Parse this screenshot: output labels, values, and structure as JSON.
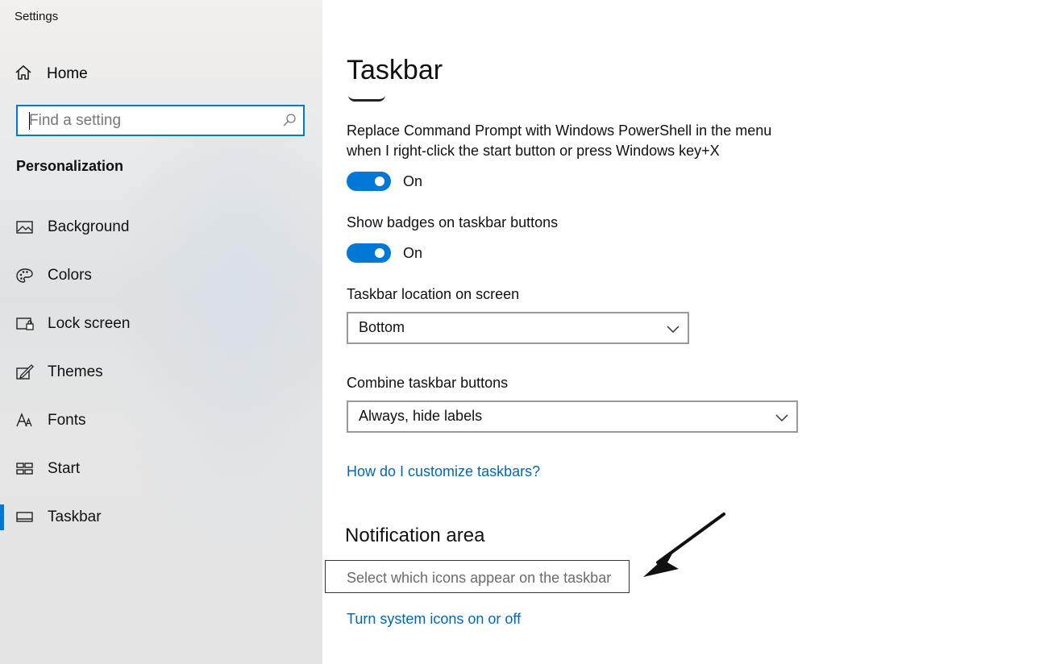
{
  "window": {
    "title": "Settings"
  },
  "sidebar": {
    "home_label": "Home",
    "search": {
      "placeholder": "Find a setting"
    },
    "section_title": "Personalization",
    "items": [
      {
        "label": "Background",
        "icon": "picture-icon"
      },
      {
        "label": "Colors",
        "icon": "palette-icon"
      },
      {
        "label": "Lock screen",
        "icon": "lock-screen-icon"
      },
      {
        "label": "Themes",
        "icon": "themes-icon"
      },
      {
        "label": "Fonts",
        "icon": "fonts-icon"
      },
      {
        "label": "Start",
        "icon": "start-icon"
      },
      {
        "label": "Taskbar",
        "icon": "taskbar-icon",
        "selected": true
      }
    ]
  },
  "main": {
    "title": "Taskbar",
    "powershell": {
      "label_line1": "Replace Command Prompt with Windows PowerShell in the menu",
      "label_line2": "when I right-click the start button or press Windows key+X",
      "state": "On"
    },
    "badges": {
      "label": "Show badges on taskbar buttons",
      "state": "On"
    },
    "location": {
      "label": "Taskbar location on screen",
      "value": "Bottom"
    },
    "combine": {
      "label": "Combine taskbar buttons",
      "value": "Always, hide labels"
    },
    "help_link": "How do I customize taskbars?",
    "notification": {
      "heading": "Notification area",
      "select_icons_link": "Select which icons appear on the taskbar",
      "system_icons_link": "Turn system icons on or off"
    }
  },
  "colors": {
    "accent": "#0078d7",
    "link": "#0067b8"
  }
}
